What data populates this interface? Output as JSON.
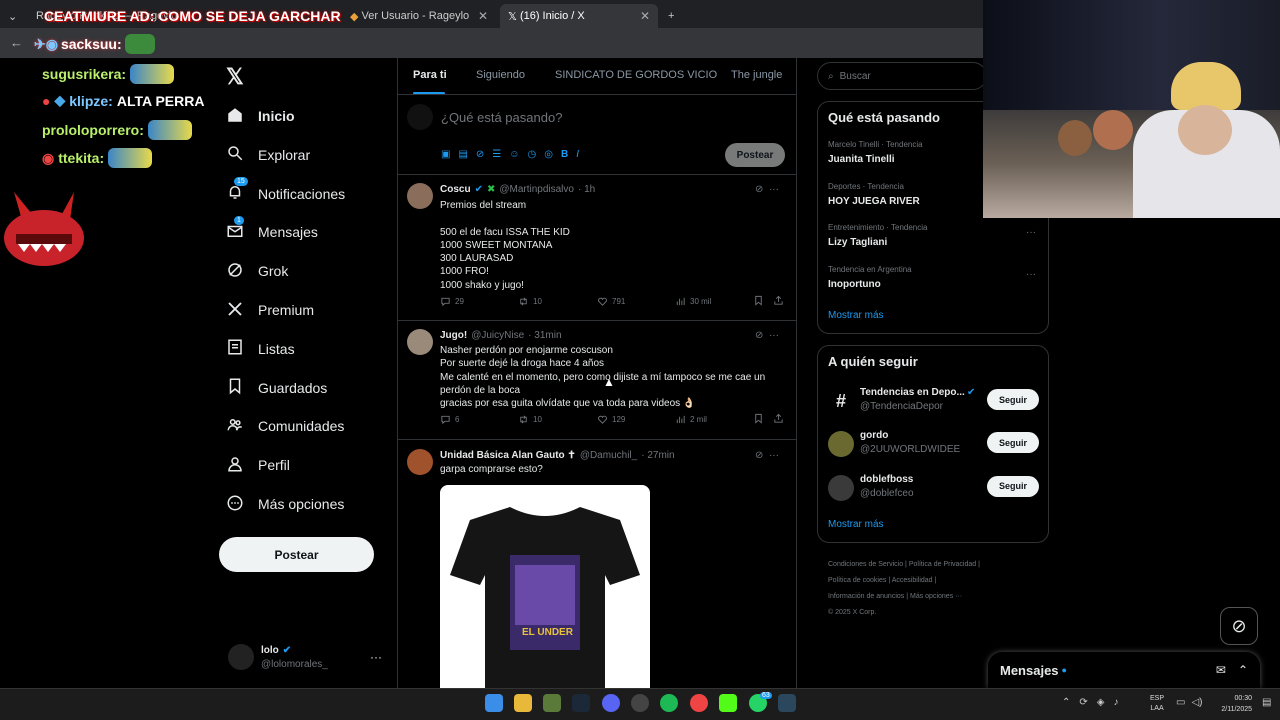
{
  "browser": {
    "tabs": [
      {
        "label": "Rageylo Ranking — Rageylo"
      },
      {
        "label": "Ver Usuario - Rageylo"
      },
      {
        "label": "(16) Inicio / X"
      }
    ],
    "new_tab": "+"
  },
  "stream_overlay": {
    "alert_text": "CEATMIURE AD: COMO SE DEJA GARCHAR",
    "alert_user": "sacksuu:",
    "chat": [
      {
        "user": "sugusrikera:",
        "message": ""
      },
      {
        "user": "klipze:",
        "message": "ALTA PERRA"
      },
      {
        "user": "prololoporrero:",
        "message": ""
      },
      {
        "user": "ttekita:",
        "message": ""
      }
    ]
  },
  "sidebar": {
    "items": [
      {
        "label": "Inicio",
        "icon": "home-icon"
      },
      {
        "label": "Explorar",
        "icon": "search-icon"
      },
      {
        "label": "Notificaciones",
        "icon": "bell-icon",
        "badge": "15"
      },
      {
        "label": "Mensajes",
        "icon": "mail-icon",
        "badge": "1"
      },
      {
        "label": "Grok",
        "icon": "grok-icon"
      },
      {
        "label": "Premium",
        "icon": "x-logo-icon"
      },
      {
        "label": "Listas",
        "icon": "list-icon"
      },
      {
        "label": "Guardados",
        "icon": "bookmark-icon"
      },
      {
        "label": "Comunidades",
        "icon": "people-icon"
      },
      {
        "label": "Perfil",
        "icon": "person-icon"
      },
      {
        "label": "Más opciones",
        "icon": "more-circle-icon"
      }
    ],
    "post_button": "Postear",
    "account": {
      "name": "lolo",
      "handle": "@lolomorales_",
      "more": "···"
    }
  },
  "feed": {
    "tabs": [
      "Para ti",
      "Siguiendo",
      "SINDICATO DE GORDOS VICIO",
      "The jungle"
    ],
    "composer": {
      "placeholder": "¿Qué está pasando?",
      "post_button": "Postear"
    },
    "tweets": [
      {
        "name": "Coscu",
        "handle": "@Martinpdisalvo",
        "time": "· 1h",
        "lines": [
          "Premios del stream",
          "",
          "500 el de facu ISSA THE KID",
          "1000 SWEET MONTANA",
          "300 LAURASAD",
          "1000 FRO!",
          "1000 shako y jugo!"
        ],
        "replies": "29",
        "retweets": "10",
        "likes": "791",
        "views": "30 mil"
      },
      {
        "name": "Jugo!",
        "handle": "@JuicyNise",
        "time": "· 31min",
        "lines": [
          "Nasher perdón por enojarme coscuson",
          "Por suerte dejé la droga hace 4 años",
          "Me calenté en el momento, pero como dijiste a mí tampoco se me cae un",
          "perdón de la boca",
          "gracias por esa guita olvídate que va toda para videos 👌🏻"
        ],
        "replies": "6",
        "retweets": "10",
        "likes": "129",
        "views": "2 mil"
      },
      {
        "name": "Unidad Básica Alan Gauto ✝",
        "handle": "@Damuchil_",
        "time": "· 27min",
        "lines": [
          "garpa comprarse esto?"
        ],
        "shirt_text": "EL UNDER"
      }
    ]
  },
  "right": {
    "search_placeholder": "Buscar",
    "trends_title": "Qué está pasando",
    "trends": [
      {
        "meta": "Marcelo Tinelli · Tendencia",
        "name": "Juanita Tinelli"
      },
      {
        "meta": "Deportes · Tendencia",
        "name": "HOY JUEGA RIVER"
      },
      {
        "meta": "Entretenimiento · Tendencia",
        "name": "Lizy Tagliani"
      },
      {
        "meta": "Tendencia en Argentina",
        "name": "Inoportuno"
      }
    ],
    "show_more": "Mostrar más",
    "follow_title": "A quién seguir",
    "follow": [
      {
        "name": "Tendencias en Depo...",
        "handle": "@TendenciaDepor"
      },
      {
        "name": "gordo",
        "handle": "@2UUWORLDWIDEE"
      },
      {
        "name": "doblefboss",
        "handle": "@doblefceo"
      }
    ],
    "follow_button": "Seguir",
    "show_more_2": "Mostrar más",
    "footer": [
      "Condiciones de Servicio",
      "Política de Privacidad",
      "Política de cookies",
      "Accesibilidad",
      "Información de anuncios",
      "Más opciones ···",
      "© 2025 X Corp."
    ],
    "messages_label": "Mensajes"
  },
  "taskbar": {
    "lang": "ESP",
    "lang2": "LAA",
    "time": "00:30",
    "date": "2/11/2025",
    "whatsapp_badge": "63"
  },
  "colors": {
    "accent": "#1d9bf0",
    "bg": "#000000",
    "border": "#2f3336",
    "muted": "#71767b"
  }
}
